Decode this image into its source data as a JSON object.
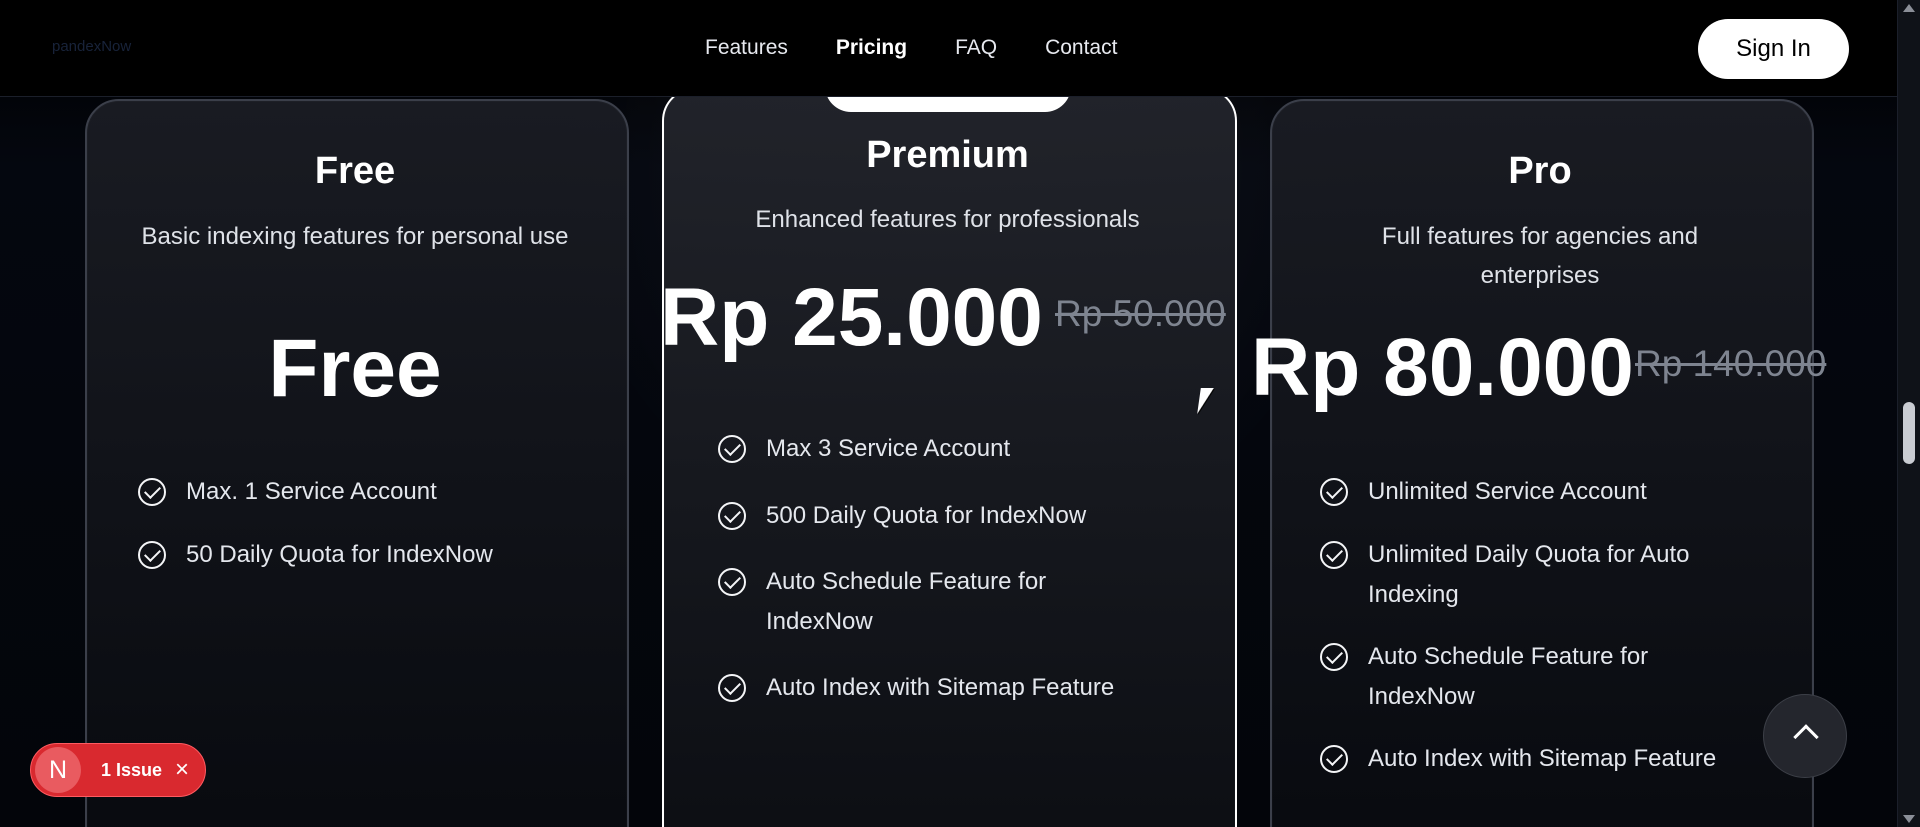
{
  "brand": {
    "label": "pandexNow"
  },
  "nav": {
    "features": "Features",
    "pricing": "Pricing",
    "faq": "FAQ",
    "contact": "Contact",
    "signin": "Sign In"
  },
  "plans": {
    "free": {
      "title": "Free",
      "description": "Basic indexing features for personal use",
      "price": "Free",
      "features": [
        "Max. 1 Service Account",
        "50 Daily Quota for IndexNow"
      ]
    },
    "premium": {
      "title": "Premium",
      "description": "Enhanced features for professionals",
      "price": "Rp 25.000",
      "old_price": "Rp 50.000",
      "features": [
        "Max 3 Service Account",
        "500 Daily Quota for IndexNow",
        "Auto Schedule Feature for IndexNow",
        "Auto Index with Sitemap Feature"
      ]
    },
    "pro": {
      "title": "Pro",
      "description": "Full features for agencies and enterprises",
      "price": "Rp 80.000",
      "old_price": "Rp 140.000",
      "features": [
        "Unlimited Service Account",
        "Unlimited Daily Quota for Auto Indexing",
        "Auto Schedule Feature for IndexNow",
        "Auto Index with Sitemap Feature"
      ]
    }
  },
  "issue": {
    "logo": "N",
    "label": "1 Issue",
    "close": "×"
  },
  "icons": {
    "check": "check-circle-icon",
    "scroll_top": "chevron-up-icon",
    "close": "close-icon"
  },
  "colors": {
    "background": "#05070d",
    "accent": "#ffffff",
    "issue": "#d9292f"
  }
}
